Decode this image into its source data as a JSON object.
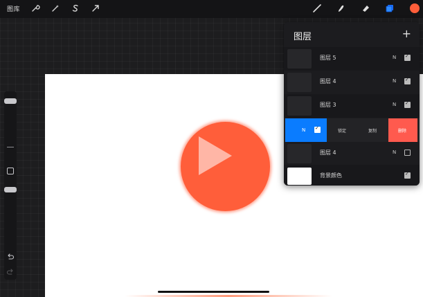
{
  "topbar": {
    "gallery_label": "图库",
    "action_icons": [
      "wrench-icon",
      "magic-wand-icon",
      "selection-s-icon",
      "transform-arrow-icon"
    ],
    "tool_icons": [
      "brush-icon",
      "smudge-icon",
      "eraser-icon",
      "layers-icon"
    ],
    "current_color": "#ff5e3a"
  },
  "layers_panel": {
    "title": "图层",
    "add_label": "+",
    "layers": [
      {
        "name": "图层 5",
        "blend": "N",
        "visible": true
      },
      {
        "name": "图层 4",
        "blend": "N",
        "visible": true
      },
      {
        "name": "图层 3",
        "blend": "N",
        "visible": true
      }
    ],
    "swipe_row": {
      "blend": "N",
      "visible": true,
      "lock_label": "锁定",
      "duplicate_label": "复制",
      "delete_label": "删除"
    },
    "lower_layer": {
      "name": "图层 4",
      "blend": "N",
      "visible": false
    },
    "background": {
      "name": "背景颜色",
      "visible": true
    }
  },
  "colors": {
    "accent_blue": "#0a7cff",
    "delete_red": "#ff5a4e",
    "shape_orange": "#ff5e3a"
  }
}
